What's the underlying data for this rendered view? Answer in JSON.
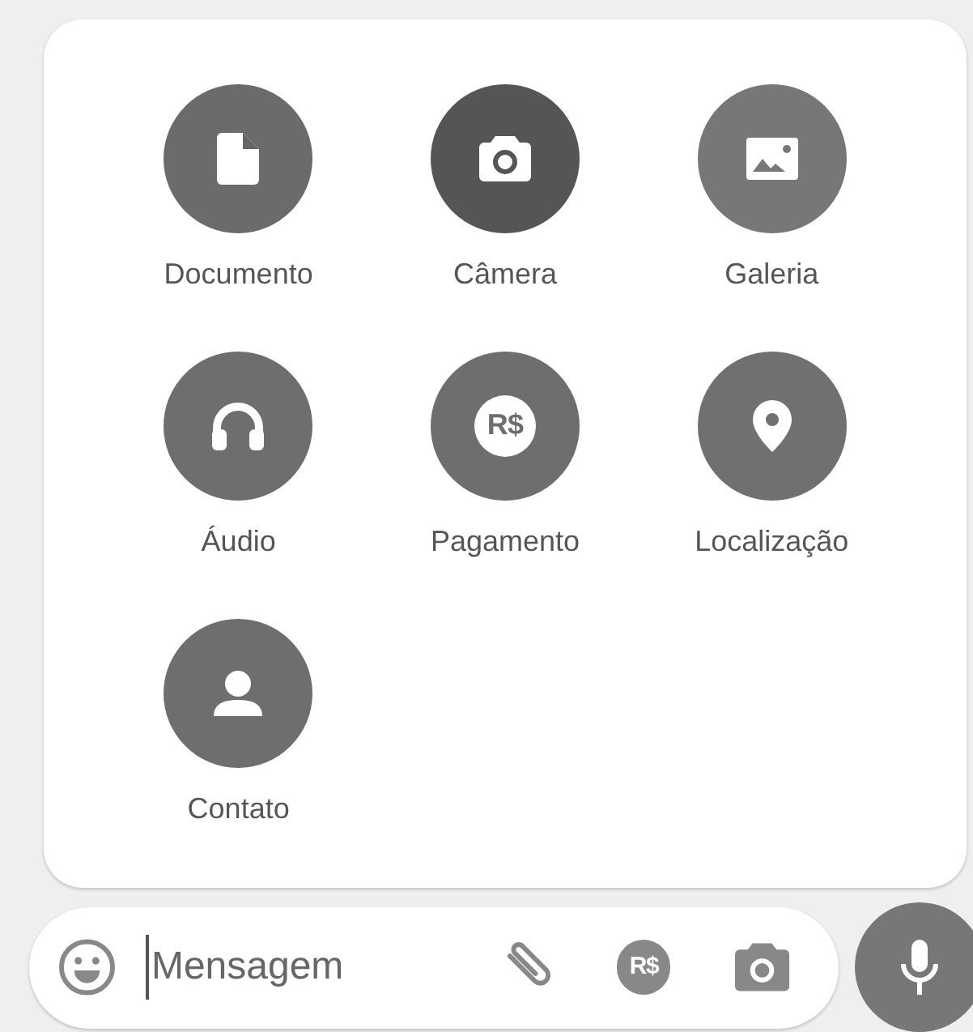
{
  "attach_menu": {
    "items": [
      {
        "label": "Documento",
        "kind": "document",
        "color": "#6b6b6b"
      },
      {
        "label": "Câmera",
        "kind": "camera",
        "color": "#555555"
      },
      {
        "label": "Galeria",
        "kind": "gallery",
        "color": "#777777"
      },
      {
        "label": "Áudio",
        "kind": "audio",
        "color": "#6e6e6e"
      },
      {
        "label": "Pagamento",
        "kind": "payment",
        "color": "#6e6e6e",
        "icon_text": "R$"
      },
      {
        "label": "Localização",
        "kind": "location",
        "color": "#707070"
      },
      {
        "label": "Contato",
        "kind": "contact",
        "color": "#6e6e6e"
      }
    ]
  },
  "composer": {
    "placeholder": "Mensagem",
    "payment_icon_text": "R$"
  }
}
